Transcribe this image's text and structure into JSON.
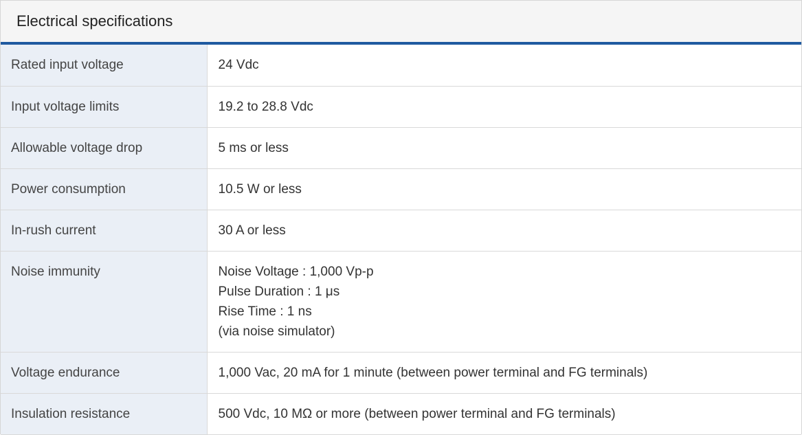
{
  "section": {
    "title": "Electrical specifications"
  },
  "rows": [
    {
      "label": "Rated input voltage",
      "values": [
        "24 Vdc"
      ]
    },
    {
      "label": "Input voltage limits",
      "values": [
        "19.2 to 28.8 Vdc"
      ]
    },
    {
      "label": "Allowable voltage drop",
      "values": [
        "5 ms or less"
      ]
    },
    {
      "label": "Power consumption",
      "values": [
        "10.5 W or less"
      ]
    },
    {
      "label": "In-rush current",
      "values": [
        "30 A or less"
      ]
    },
    {
      "label": "Noise immunity",
      "values": [
        "Noise Voltage : 1,000 Vp-p",
        "Pulse Duration : 1 μs",
        "Rise Time : 1 ns",
        "(via noise simulator)"
      ]
    },
    {
      "label": "Voltage endurance",
      "values": [
        "1,000 Vac, 20 mA for 1 minute (between power terminal and FG terminals)"
      ]
    },
    {
      "label": "Insulation resistance",
      "values": [
        "500 Vdc, 10 MΩ or more (between power terminal and FG terminals)"
      ]
    }
  ],
  "colors": {
    "header_background": "#f5f5f5",
    "header_rule": "#1f5aa0",
    "label_cell_background": "#eaeff6",
    "row_border": "#d9d9d9"
  }
}
